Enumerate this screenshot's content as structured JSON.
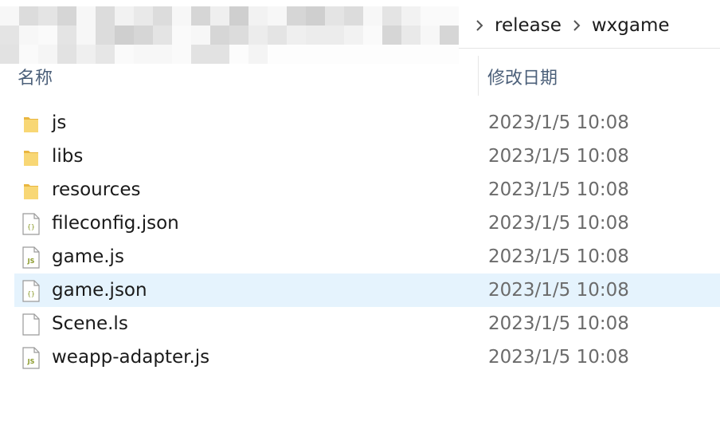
{
  "breadcrumb": {
    "items": [
      "release",
      "wxgame"
    ]
  },
  "columns": {
    "name": "名称",
    "date_modified": "修改日期"
  },
  "files": [
    {
      "name": "js",
      "date": "2023/1/5 10:08",
      "type": "folder",
      "icon": "folder-icon"
    },
    {
      "name": "libs",
      "date": "2023/1/5 10:08",
      "type": "folder",
      "icon": "folder-icon"
    },
    {
      "name": "resources",
      "date": "2023/1/5 10:08",
      "type": "folder",
      "icon": "folder-icon"
    },
    {
      "name": "fileconfig.json",
      "date": "2023/1/5 10:08",
      "type": "json",
      "icon": "json-file-icon"
    },
    {
      "name": "game.js",
      "date": "2023/1/5 10:08",
      "type": "js",
      "icon": "js-file-icon"
    },
    {
      "name": "game.json",
      "date": "2023/1/5 10:08",
      "type": "json",
      "icon": "json-file-icon",
      "selected": true
    },
    {
      "name": "Scene.ls",
      "date": "2023/1/5 10:08",
      "type": "generic",
      "icon": "file-icon"
    },
    {
      "name": "weapp-adapter.js",
      "date": "2023/1/5 10:08",
      "type": "js",
      "icon": "js-file-icon"
    }
  ],
  "colors": {
    "selection": "#e5f3fd",
    "header_text": "#4c607a",
    "date_text": "#6b6b6b",
    "folder": "#f8d775"
  }
}
